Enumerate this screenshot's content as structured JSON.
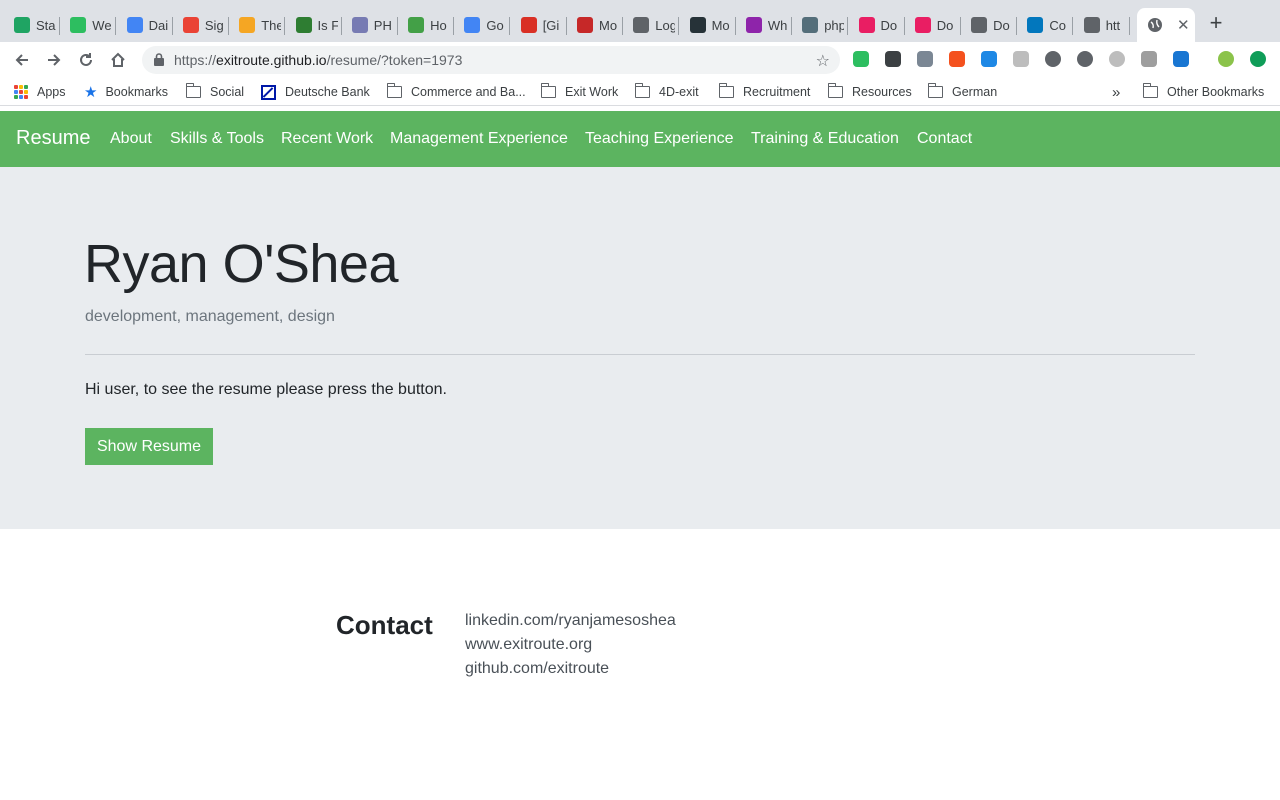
{
  "browser": {
    "tabs": [
      {
        "title": "Sta",
        "icon": "google-drive-icon",
        "color": "#1fa463"
      },
      {
        "title": "We",
        "icon": "evernote-icon",
        "color": "#2dbe60"
      },
      {
        "title": "Dai",
        "icon": "google-docs-icon",
        "color": "#4285f4"
      },
      {
        "title": "Sig",
        "icon": "google-icon",
        "color": "#ea4335"
      },
      {
        "title": "The",
        "icon": "hourglass-icon",
        "color": "#f5a623"
      },
      {
        "title": "Is F",
        "icon": "stripes-icon",
        "color": "#2e7d32"
      },
      {
        "title": "PH",
        "icon": "php-icon",
        "color": "#777bb3"
      },
      {
        "title": "Ho",
        "icon": "gear-flower-icon",
        "color": "#43a047"
      },
      {
        "title": "Go",
        "icon": "google-icon",
        "color": "#4285f4"
      },
      {
        "title": "[Gi",
        "icon": "gmail-icon",
        "color": "#d93025"
      },
      {
        "title": "Mo",
        "icon": "sig-icon",
        "color": "#c62828"
      },
      {
        "title": "Log",
        "icon": "globe-icon",
        "color": "#5f6368"
      },
      {
        "title": "Mo",
        "icon": "robot-icon",
        "color": "#263238"
      },
      {
        "title": "Wh",
        "icon": "w-icon",
        "color": "#8e24aa"
      },
      {
        "title": "php",
        "icon": "php-globe-icon",
        "color": "#546e7a"
      },
      {
        "title": "Do",
        "icon": "play-circle-icon",
        "color": "#e91e63"
      },
      {
        "title": "Do",
        "icon": "play-circle-icon",
        "color": "#e91e63"
      },
      {
        "title": "Do",
        "icon": "globe-icon",
        "color": "#5f6368"
      },
      {
        "title": "Co",
        "icon": "video-icon",
        "color": "#0277bd"
      },
      {
        "title": "htt",
        "icon": "globe-icon",
        "color": "#5f6368"
      }
    ],
    "active_tab_icon": "globe-icon",
    "url_host": "exitroute.github.io",
    "url_rest": "/resume/?token=1973",
    "url_scheme": "https://",
    "bookmarks": [
      {
        "label": "Apps",
        "icon": "apps-grid-icon"
      },
      {
        "label": "Bookmarks",
        "icon": "star-icon"
      },
      {
        "label": "Social",
        "icon": "folder-icon"
      },
      {
        "label": "Deutsche Bank",
        "icon": "deutsche-bank-icon"
      },
      {
        "label": "Commerce and Ba...",
        "icon": "folder-icon"
      },
      {
        "label": "Exit Work",
        "icon": "folder-icon"
      },
      {
        "label": "4D-exit",
        "icon": "folder-icon"
      },
      {
        "label": "Recruitment",
        "icon": "folder-icon"
      },
      {
        "label": "Resources",
        "icon": "folder-icon"
      },
      {
        "label": "German",
        "icon": "folder-icon"
      }
    ],
    "other_bookmarks": "Other Bookmarks",
    "overflow": "»"
  },
  "site": {
    "brand": "Resume",
    "nav": [
      "About",
      "Skills & Tools",
      "Recent Work",
      "Management Experience",
      "Teaching Experience",
      "Training & Education",
      "Contact"
    ],
    "name": "Ryan O'Shea",
    "tagline": "development, management, design",
    "greeting": "Hi user, to see the resume please press the button.",
    "button": "Show Resume",
    "contact_heading": "Contact",
    "contact_links": [
      "linkedin.com/ryanjamesoshea",
      "www.exitroute.org",
      "github.com/exitroute"
    ]
  },
  "colors": {
    "accent": "#5cb460",
    "jumbotron": "#e9ecef"
  }
}
